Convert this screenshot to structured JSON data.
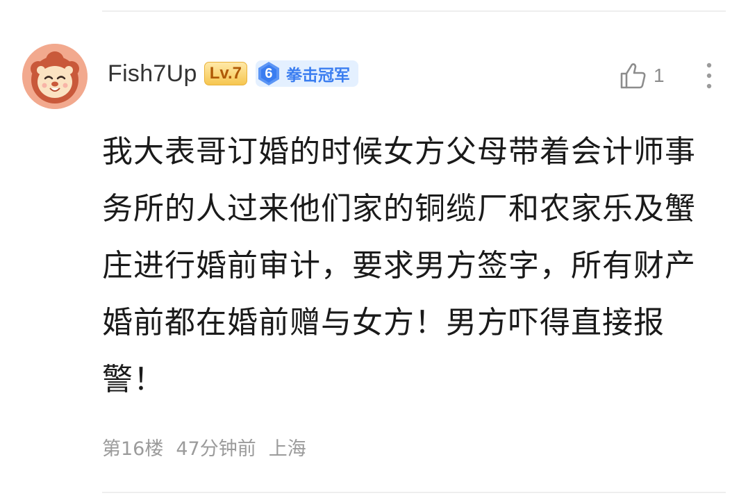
{
  "comment": {
    "author": {
      "username": "Fish7Up",
      "level": "Lv.7",
      "title_badge": {
        "number": "6",
        "text": "拳击冠军",
        "color": "#3a7df0"
      },
      "avatar_icon": "lion-avatar"
    },
    "likes": {
      "icon": "thumbs-up-icon",
      "count": "1"
    },
    "more_icon": "more-vertical-icon",
    "content": "我大表哥订婚的时候女方父母带着会计师事务所的人过来他们家的铜缆厂和农家乐及蟹庄进行婚前审计，要求男方签字，所有财产婚前都在婚前赠与女方！男方吓得直接报警！",
    "meta": {
      "floor": "第16楼",
      "time": "47分钟前",
      "location": "上海"
    }
  },
  "colors": {
    "text_primary": "#1a1a1a",
    "text_secondary": "#9b9b9b",
    "level_badge": "#f6c650",
    "title_badge_bg": "#e4f0ff"
  }
}
